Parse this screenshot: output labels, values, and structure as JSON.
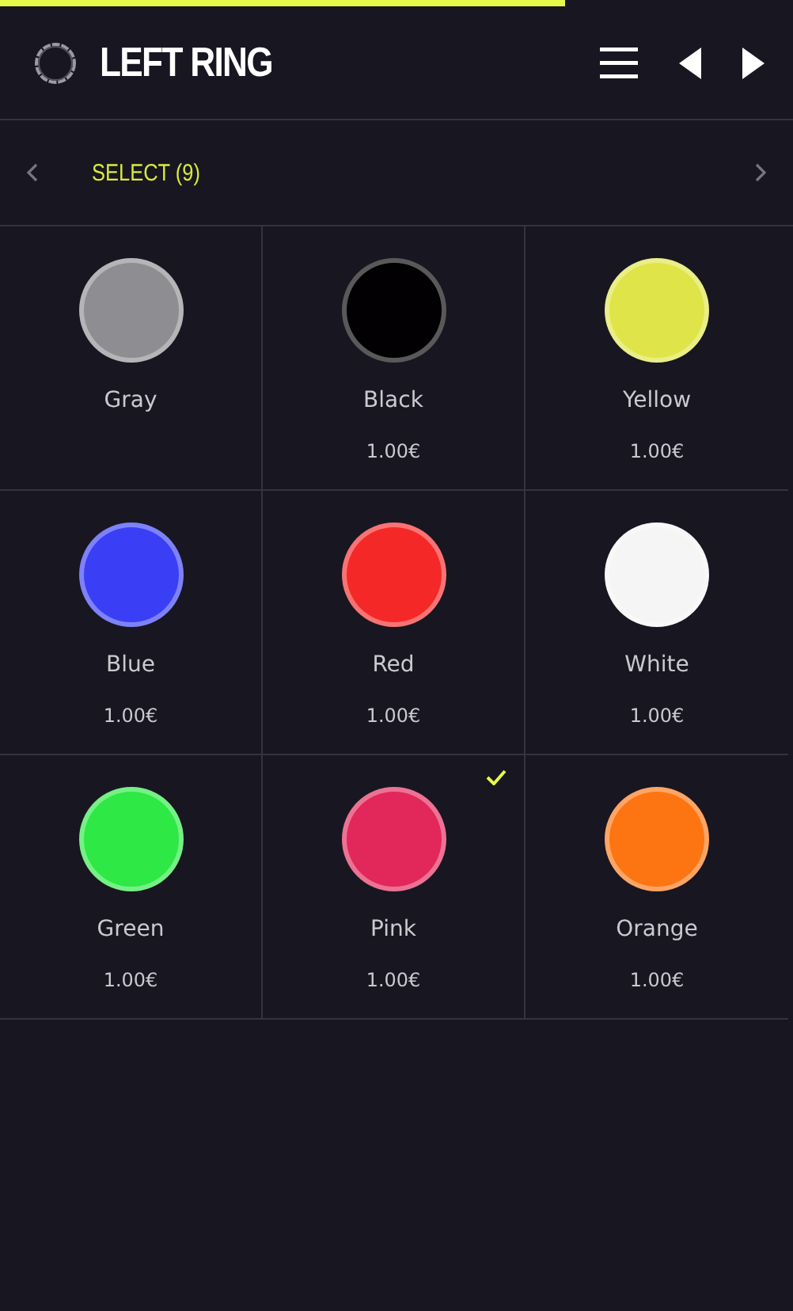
{
  "progress": {
    "level": 0.713
  },
  "header": {
    "title": "LEFT RING"
  },
  "selector": {
    "label": "SELECT (9)"
  },
  "colors": [
    {
      "name": "Gray",
      "color": "#8e8e92",
      "selected": false
    },
    {
      "name": "Black",
      "color": "#020002",
      "price": "1.00€",
      "selected": false
    },
    {
      "name": "Yellow",
      "color": "#dfe548",
      "price": "1.00€",
      "selected": false
    },
    {
      "name": "Blue",
      "color": "#3a3ff5",
      "price": "1.00€",
      "selected": false
    },
    {
      "name": "Red",
      "color": "#f52828",
      "price": "1.00€",
      "selected": false
    },
    {
      "name": "White",
      "color": "#f5f5f5",
      "price": "1.00€",
      "selected": false
    },
    {
      "name": "Green",
      "color": "#2de845",
      "price": "1.00€",
      "selected": false
    },
    {
      "name": "Pink",
      "color": "#e2275a",
      "price": "1.00€",
      "selected": true
    },
    {
      "name": "Orange",
      "color": "#fd7513",
      "price": "1.00€",
      "selected": false
    }
  ]
}
